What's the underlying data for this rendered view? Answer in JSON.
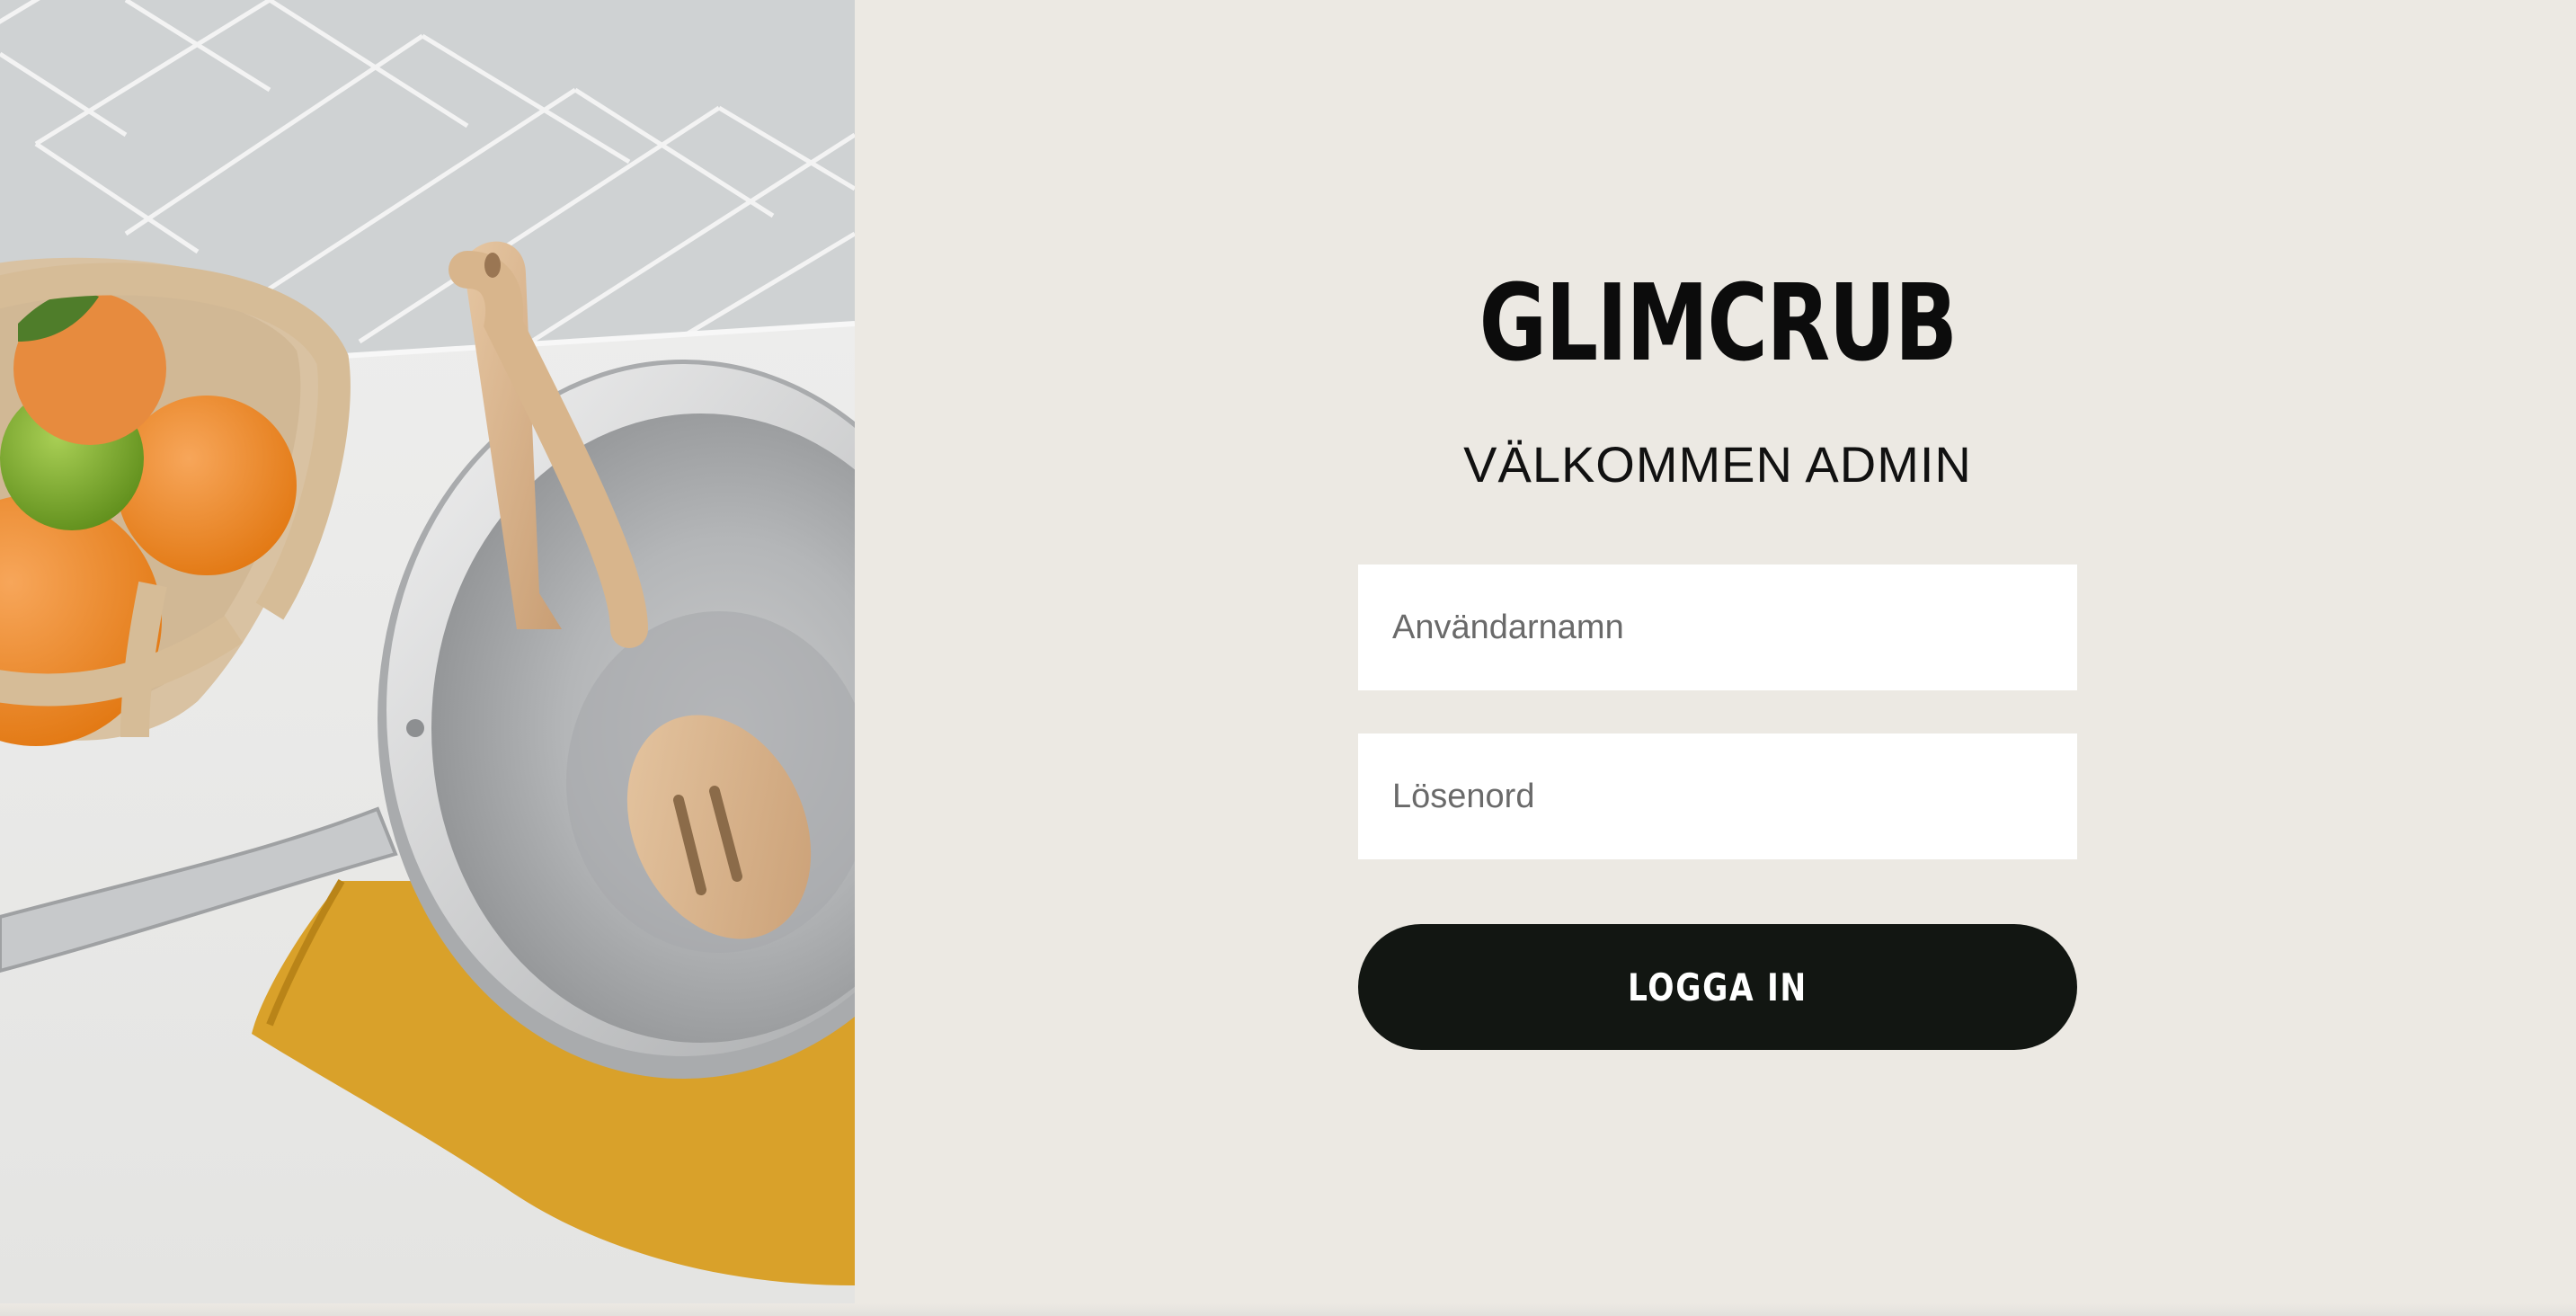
{
  "brand": {
    "name": "GLIMCRUB"
  },
  "login": {
    "welcome": "VÄLKOMMEN ADMIN",
    "username_placeholder": "Användarnamn",
    "username_value": "",
    "password_placeholder": "Lösenord",
    "password_value": "",
    "submit_label": "LOGGA IN"
  },
  "hero_image": {
    "icon": "kitchen-photo",
    "subject": "steel pan, wooden spoon, fruit bowl, mustard cloth"
  },
  "colors": {
    "background": "#ECE9E3",
    "button": "#121612",
    "button_text": "#FFFFFF",
    "field": "#FFFFFF",
    "cloth": "#D9A12A",
    "orange": "#EE8A2A",
    "lime": "#7DAE2E"
  }
}
